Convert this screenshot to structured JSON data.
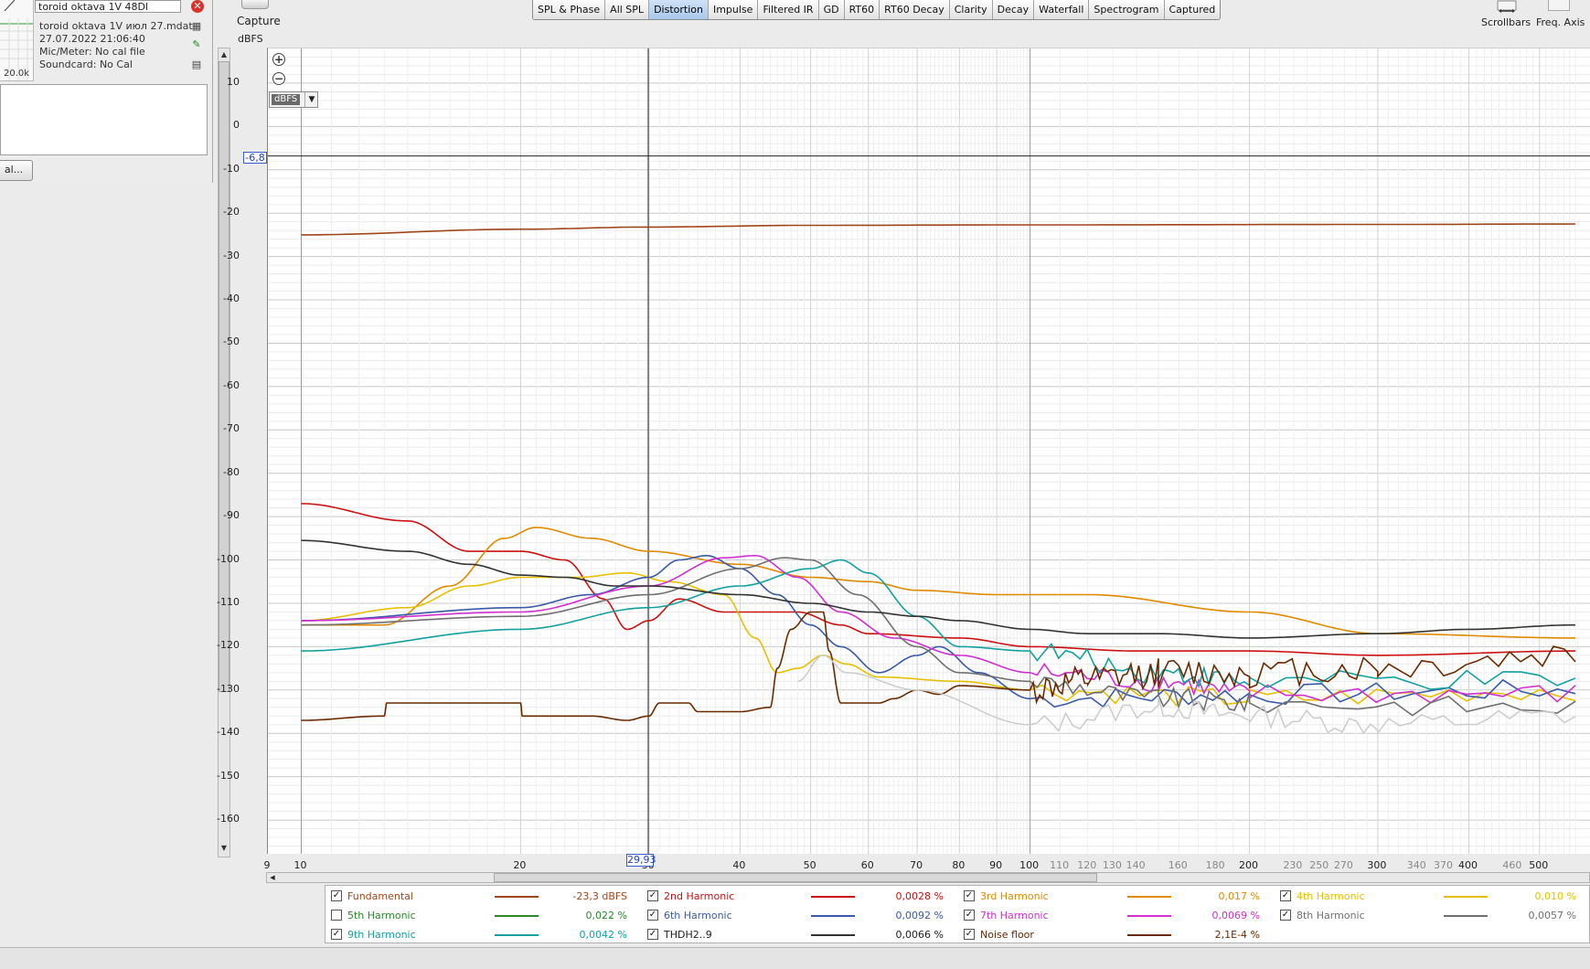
{
  "measurement": {
    "name": "toroid oktava 1V 48Dl",
    "file": "toroid oktava 1V июл 27.mdat",
    "datetime": "27.07.2022 21:06:40",
    "mic_meter": "Mic/Meter: No cal file",
    "soundcard": "Soundcard: No Cal",
    "thumb_label": "20.0k",
    "cal_button": "al..."
  },
  "toolbar": {
    "capture": "Capture",
    "unit": "dBFS",
    "tabs": [
      "SPL & Phase",
      "All SPL",
      "Distortion",
      "Impulse",
      "Filtered IR",
      "GD",
      "RT60",
      "RT60 Decay",
      "Clarity",
      "Decay",
      "Waterfall",
      "Spectrogram",
      "Captured"
    ],
    "active_tab": "Distortion",
    "scrollbars": "Scrollbars",
    "freq_axis": "Freq. Axis"
  },
  "plot": {
    "unit_select": "dBFS",
    "cursor_y": "-6,8",
    "cursor_x": "29,93",
    "y_ticks": [
      "10",
      "0",
      "-10",
      "-20",
      "-30",
      "-40",
      "-50",
      "-60",
      "-70",
      "-80",
      "-90",
      "-100",
      "-110",
      "-120",
      "-130",
      "-140",
      "-150",
      "-160"
    ],
    "x_ticks_major": [
      "9",
      "10",
      "20",
      "30",
      "40",
      "50",
      "60",
      "70",
      "80",
      "90",
      "100",
      "200",
      "300",
      "400",
      "500"
    ],
    "x_ticks_minor": [
      "110",
      "120",
      "130",
      "140",
      "160",
      "180",
      "230",
      "250",
      "270",
      "340",
      "370",
      "460"
    ]
  },
  "chart_data": {
    "type": "line",
    "xlabel": "",
    "ylabel": "dBFS",
    "x_scale": "log",
    "xlim": [
      9,
      560
    ],
    "ylim": [
      -168,
      18
    ],
    "grid": true,
    "series": [
      {
        "name": "Fundamental",
        "color": "#a0461a",
        "points": [
          [
            10,
            -25
          ],
          [
            20,
            -23.7
          ],
          [
            30,
            -23.2
          ],
          [
            50,
            -22.8
          ],
          [
            100,
            -22.7
          ],
          [
            300,
            -22.6
          ],
          [
            560,
            -22.5
          ]
        ]
      },
      {
        "name": "2nd Harmonic",
        "color": "#cc1111",
        "points": [
          [
            10,
            -87
          ],
          [
            14,
            -91
          ],
          [
            17,
            -98
          ],
          [
            20,
            -98
          ],
          [
            23,
            -100
          ],
          [
            26,
            -109
          ],
          [
            28,
            -116
          ],
          [
            30,
            -114
          ],
          [
            33,
            -109
          ],
          [
            38,
            -112
          ],
          [
            44,
            -112
          ],
          [
            48,
            -112
          ],
          [
            55,
            -115
          ],
          [
            60,
            -117
          ],
          [
            80,
            -118
          ],
          [
            100,
            -120
          ],
          [
            140,
            -121
          ],
          [
            200,
            -121
          ],
          [
            300,
            -122
          ],
          [
            560,
            -121
          ]
        ]
      },
      {
        "name": "3rd Harmonic",
        "color": "#e08a00",
        "points": [
          [
            10,
            -115
          ],
          [
            13,
            -115
          ],
          [
            16,
            -106
          ],
          [
            19,
            -95
          ],
          [
            21,
            -92.5
          ],
          [
            25,
            -95
          ],
          [
            30,
            -98
          ],
          [
            40,
            -101
          ],
          [
            50,
            -104
          ],
          [
            60,
            -105
          ],
          [
            70,
            -107
          ],
          [
            90,
            -108
          ],
          [
            120,
            -108
          ],
          [
            200,
            -112
          ],
          [
            300,
            -117
          ],
          [
            560,
            -118
          ]
        ]
      },
      {
        "name": "4th Harmonic",
        "color": "#e6c000",
        "points": [
          [
            10,
            -114
          ],
          [
            14,
            -111
          ],
          [
            17,
            -106
          ],
          [
            20,
            -104
          ],
          [
            24,
            -104
          ],
          [
            28,
            -103
          ],
          [
            32,
            -105
          ],
          [
            38,
            -108
          ],
          [
            42,
            -118
          ],
          [
            45,
            -126
          ],
          [
            48,
            -125
          ],
          [
            52,
            -122
          ],
          [
            56,
            -124
          ],
          [
            62,
            -127
          ],
          [
            80,
            -128
          ],
          [
            100,
            -130
          ],
          [
            200,
            -132
          ],
          [
            560,
            -130
          ]
        ]
      },
      {
        "name": "6th Harmonic",
        "color": "#3a5aa8",
        "points": [
          [
            10,
            -114
          ],
          [
            20,
            -111
          ],
          [
            25,
            -108
          ],
          [
            30,
            -104
          ],
          [
            33,
            -100
          ],
          [
            36,
            -99
          ],
          [
            40,
            -102
          ],
          [
            45,
            -108
          ],
          [
            50,
            -115
          ],
          [
            55,
            -120
          ],
          [
            62,
            -126
          ],
          [
            70,
            -122
          ],
          [
            75,
            -120
          ],
          [
            85,
            -126
          ],
          [
            100,
            -132
          ],
          [
            200,
            -131
          ],
          [
            560,
            -130
          ]
        ]
      },
      {
        "name": "7th Harmonic",
        "color": "#d030d0",
        "points": [
          [
            10,
            -114
          ],
          [
            20,
            -112
          ],
          [
            30,
            -106
          ],
          [
            38,
            -99.5
          ],
          [
            42,
            -99
          ],
          [
            48,
            -104
          ],
          [
            55,
            -112
          ],
          [
            65,
            -118
          ],
          [
            80,
            -122
          ],
          [
            100,
            -126
          ],
          [
            150,
            -128
          ],
          [
            200,
            -131
          ],
          [
            560,
            -131
          ]
        ]
      },
      {
        "name": "8th Harmonic",
        "color": "#707070",
        "points": [
          [
            10,
            -115
          ],
          [
            20,
            -113
          ],
          [
            30,
            -108
          ],
          [
            40,
            -102
          ],
          [
            46,
            -99.5
          ],
          [
            50,
            -100
          ],
          [
            58,
            -108
          ],
          [
            70,
            -120
          ],
          [
            80,
            -126
          ],
          [
            100,
            -128
          ],
          [
            150,
            -132
          ],
          [
            200,
            -133
          ],
          [
            560,
            -134
          ]
        ]
      },
      {
        "name": "9th Harmonic",
        "color": "#14a0a0",
        "points": [
          [
            10,
            -121
          ],
          [
            20,
            -116
          ],
          [
            30,
            -111
          ],
          [
            40,
            -106
          ],
          [
            50,
            -102
          ],
          [
            55,
            -100
          ],
          [
            60,
            -103
          ],
          [
            70,
            -113
          ],
          [
            80,
            -120
          ],
          [
            100,
            -121
          ],
          [
            150,
            -126
          ],
          [
            200,
            -128
          ],
          [
            560,
            -128
          ]
        ]
      },
      {
        "name": "THD H2..9",
        "color": "#333333",
        "points": [
          [
            10,
            -95.5
          ],
          [
            14,
            -98
          ],
          [
            17,
            -101
          ],
          [
            20,
            -103.5
          ],
          [
            23,
            -104
          ],
          [
            27,
            -106
          ],
          [
            30,
            -106
          ],
          [
            40,
            -108
          ],
          [
            50,
            -110
          ],
          [
            60,
            -112
          ],
          [
            70,
            -113
          ],
          [
            80,
            -114
          ],
          [
            100,
            -116
          ],
          [
            120,
            -117
          ],
          [
            150,
            -117
          ],
          [
            200,
            -118
          ],
          [
            300,
            -117
          ],
          [
            400,
            -116
          ],
          [
            560,
            -115
          ]
        ]
      },
      {
        "name": "Noise floor",
        "color": "#6a2a00",
        "points": [
          [
            10,
            -137
          ],
          [
            13,
            -136
          ],
          [
            13.1,
            -133
          ],
          [
            20,
            -133
          ],
          [
            20.1,
            -136
          ],
          [
            25,
            -136
          ],
          [
            28,
            -137
          ],
          [
            30,
            -136
          ],
          [
            31,
            -133
          ],
          [
            34,
            -133
          ],
          [
            35,
            -135
          ],
          [
            40,
            -135
          ],
          [
            44,
            -134
          ],
          [
            45,
            -125
          ],
          [
            47,
            -116
          ],
          [
            50,
            -112
          ],
          [
            52,
            -112
          ],
          [
            53,
            -121
          ],
          [
            55,
            -133
          ],
          [
            62,
            -133
          ],
          [
            65,
            -132
          ],
          [
            70,
            -130
          ],
          [
            75,
            -131
          ],
          [
            80,
            -129
          ],
          [
            100,
            -130
          ],
          [
            120,
            -128
          ],
          [
            150,
            -126
          ],
          [
            200,
            -126
          ],
          [
            300,
            -125
          ],
          [
            560,
            -122
          ]
        ]
      },
      {
        "name": "Noise (gray)",
        "color": "#cccccc",
        "points": [
          [
            48,
            -128
          ],
          [
            52,
            -122
          ],
          [
            56,
            -126
          ],
          [
            70,
            -130
          ],
          [
            100,
            -138
          ],
          [
            150,
            -134
          ],
          [
            200,
            -136
          ],
          [
            300,
            -138
          ],
          [
            560,
            -136
          ]
        ]
      }
    ]
  },
  "legend": [
    {
      "name": "Fundamental",
      "checked": true,
      "color": "#a0461a",
      "value": "-23,3 dBFS"
    },
    {
      "name": "2nd Harmonic",
      "checked": true,
      "color": "#cc1111",
      "value": "0,0028 %"
    },
    {
      "name": "3rd Harmonic",
      "checked": true,
      "color": "#e08a00",
      "value": "0,017 %"
    },
    {
      "name": "4th Harmonic",
      "checked": true,
      "color": "#e6c000",
      "value": "0,010 %"
    },
    {
      "name": "5th Harmonic",
      "checked": false,
      "color": "#2a8a2a",
      "value": "0,022 %"
    },
    {
      "name": "6th Harmonic",
      "checked": true,
      "color": "#3a5aa8",
      "value": "0,0092 %"
    },
    {
      "name": "7th Harmonic",
      "checked": true,
      "color": "#d030d0",
      "value": "0,0069 %"
    },
    {
      "name": "8th Harmonic",
      "checked": true,
      "color": "#707070",
      "value": "0,0057 %"
    },
    {
      "name": "9th Harmonic",
      "checked": true,
      "color": "#14a0a0",
      "value": "0,0042 %"
    },
    {
      "name": "THDH2..9",
      "checked": true,
      "color": "#333333",
      "value": "0,0066 %"
    },
    {
      "name": "Noise floor",
      "checked": true,
      "color": "#6a2a00",
      "value": "2,1E-4 %"
    }
  ]
}
